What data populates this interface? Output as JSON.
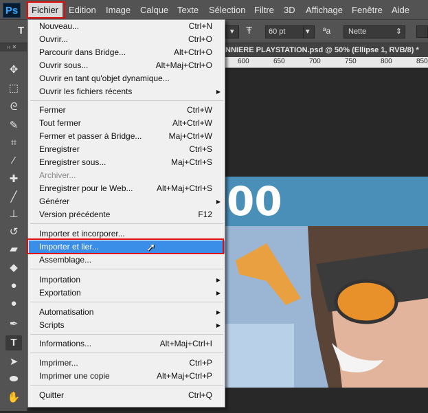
{
  "app": {
    "logo": "Ps"
  },
  "menubar": {
    "items": [
      {
        "label": "Fichier"
      },
      {
        "label": "Edition"
      },
      {
        "label": "Image"
      },
      {
        "label": "Calque"
      },
      {
        "label": "Texte"
      },
      {
        "label": "Sélection"
      },
      {
        "label": "Filtre"
      },
      {
        "label": "3D"
      },
      {
        "label": "Affichage"
      },
      {
        "label": "Fenêtre"
      },
      {
        "label": "Aide"
      }
    ]
  },
  "options": {
    "tool_glyph": "T",
    "font_size": "60 pt",
    "antialias_glyph": "ªa",
    "antialias": "Nette"
  },
  "document": {
    "tab_title": "NNIERE PLAYSTATION.psd @ 50% (Ellipse 1, RVB/8) *",
    "ruler_labels": [
      "600",
      "650",
      "700",
      "750",
      "800",
      "850"
    ],
    "canvas_text": "00"
  },
  "file_menu": {
    "items": [
      {
        "label": "Nouveau...",
        "shortcut": "Ctrl+N"
      },
      {
        "label": "Ouvrir...",
        "shortcut": "Ctrl+O"
      },
      {
        "label": "Parcourir dans Bridge...",
        "shortcut": "Alt+Ctrl+O"
      },
      {
        "label": "Ouvrir sous...",
        "shortcut": "Alt+Maj+Ctrl+O"
      },
      {
        "label": "Ouvrir en tant qu'objet dynamique...",
        "shortcut": ""
      },
      {
        "label": "Ouvrir les fichiers récents",
        "shortcut": ""
      },
      {
        "label": "Fermer",
        "shortcut": "Ctrl+W"
      },
      {
        "label": "Tout fermer",
        "shortcut": "Alt+Ctrl+W"
      },
      {
        "label": "Fermer et passer à Bridge...",
        "shortcut": "Maj+Ctrl+W"
      },
      {
        "label": "Enregistrer",
        "shortcut": "Ctrl+S"
      },
      {
        "label": "Enregistrer sous...",
        "shortcut": "Maj+Ctrl+S"
      },
      {
        "label": "Archiver...",
        "shortcut": ""
      },
      {
        "label": "Enregistrer pour le Web...",
        "shortcut": "Alt+Maj+Ctrl+S"
      },
      {
        "label": "Générer",
        "shortcut": ""
      },
      {
        "label": "Version précédente",
        "shortcut": "F12"
      },
      {
        "label": "Importer et incorporer...",
        "shortcut": ""
      },
      {
        "label": "Importer et lier...",
        "shortcut": ""
      },
      {
        "label": "Assemblage...",
        "shortcut": ""
      },
      {
        "label": "Importation",
        "shortcut": ""
      },
      {
        "label": "Exportation",
        "shortcut": ""
      },
      {
        "label": "Automatisation",
        "shortcut": ""
      },
      {
        "label": "Scripts",
        "shortcut": ""
      },
      {
        "label": "Informations...",
        "shortcut": "Alt+Maj+Ctrl+I"
      },
      {
        "label": "Imprimer...",
        "shortcut": "Ctrl+P"
      },
      {
        "label": "Imprimer une copie",
        "shortcut": "Alt+Maj+Ctrl+P"
      },
      {
        "label": "Quitter",
        "shortcut": "Ctrl+Q"
      }
    ]
  },
  "colors": {
    "highlight": "#3b8ee8",
    "annotation_red": "#e01010",
    "banner_blue": "#4a8fb8"
  }
}
